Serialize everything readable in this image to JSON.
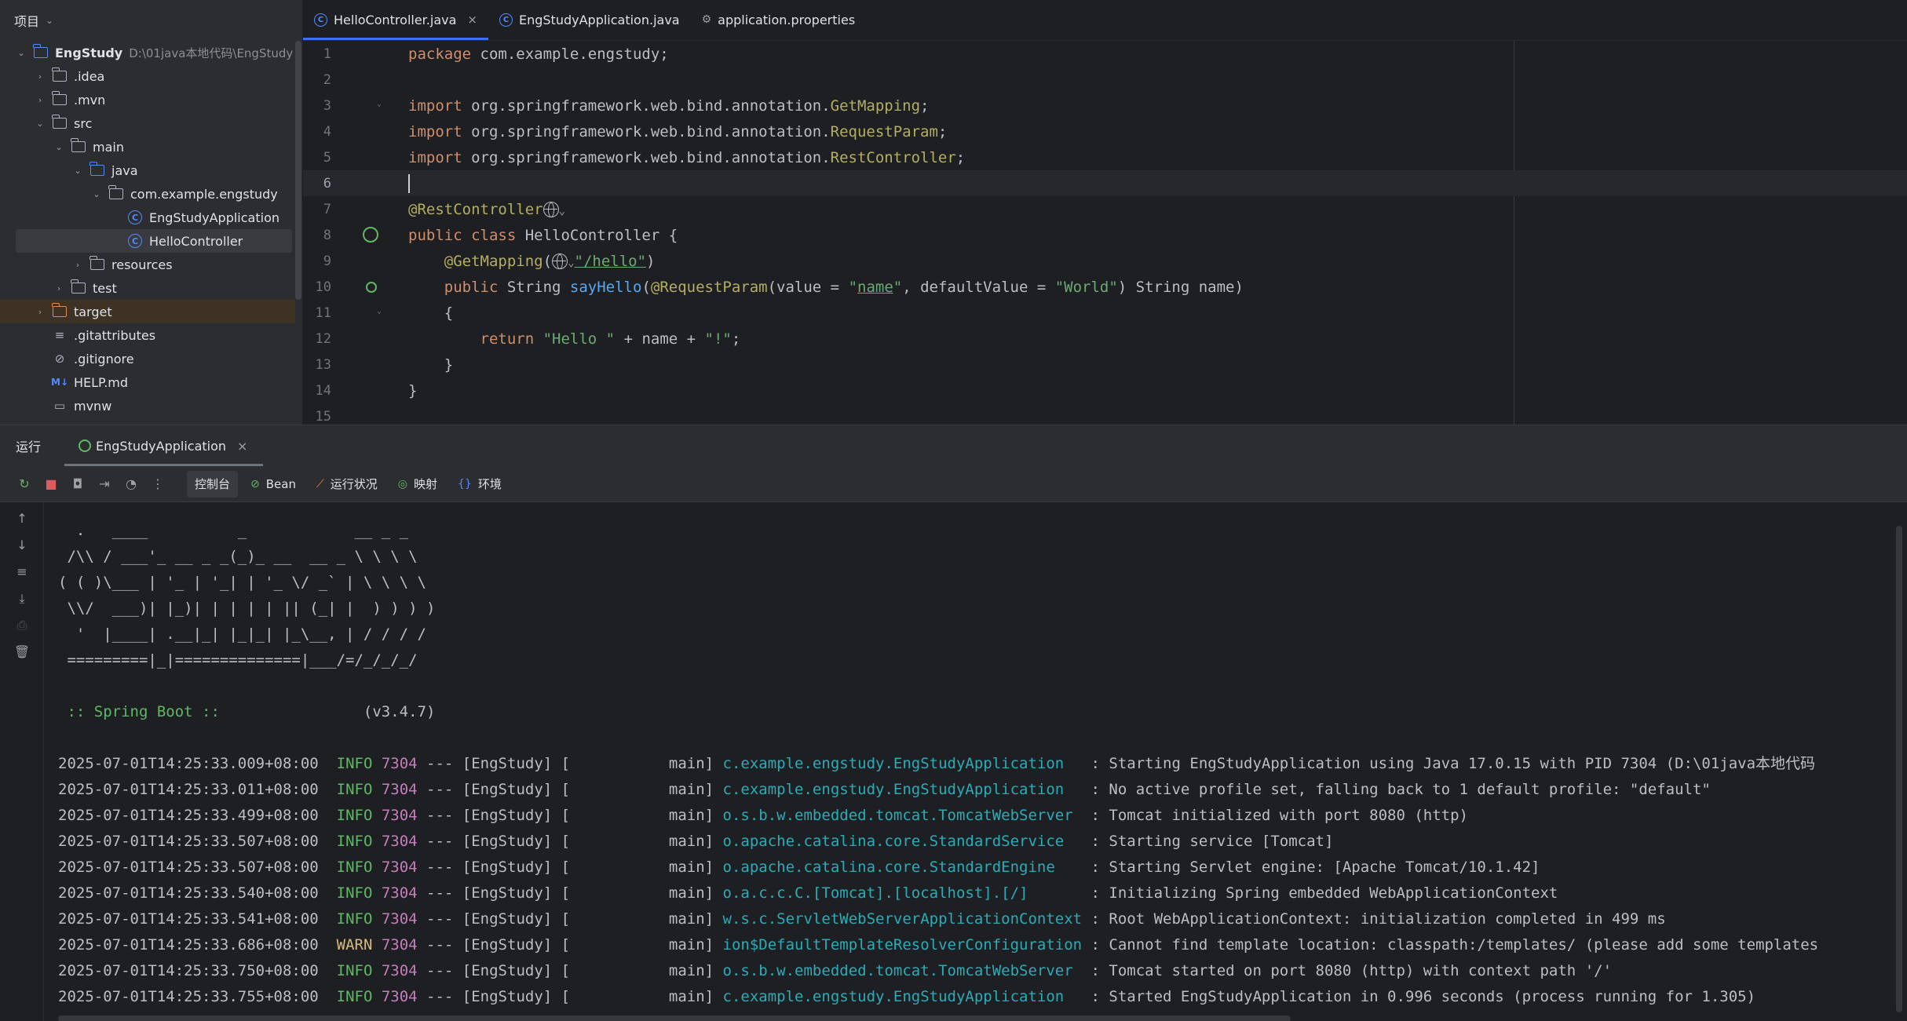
{
  "project": {
    "title": "项目",
    "tree": [
      {
        "label": "EngStudy",
        "hint": "D:\\01java本地代码\\EngStudy",
        "type": "module",
        "arrow": "▾",
        "depth": 0
      },
      {
        "label": ".idea",
        "type": "folder",
        "arrow": "›",
        "depth": 1
      },
      {
        "label": ".mvn",
        "type": "folder",
        "arrow": "›",
        "depth": 1
      },
      {
        "label": "src",
        "type": "folder",
        "arrow": "▾",
        "depth": 1
      },
      {
        "label": "main",
        "type": "folder",
        "arrow": "▾",
        "depth": 2
      },
      {
        "label": "java",
        "type": "folder-blue",
        "arrow": "▾",
        "depth": 3
      },
      {
        "label": "com.example.engstudy",
        "type": "package",
        "arrow": "▾",
        "depth": 4
      },
      {
        "label": "EngStudyApplication",
        "type": "class",
        "arrow": "",
        "depth": 5
      },
      {
        "label": "HelloController",
        "type": "class",
        "arrow": "",
        "depth": 5,
        "selected": true
      },
      {
        "label": "resources",
        "type": "folder",
        "arrow": "›",
        "depth": 3
      },
      {
        "label": "test",
        "type": "folder",
        "arrow": "›",
        "depth": 2
      },
      {
        "label": "target",
        "type": "folder-orange",
        "arrow": "›",
        "depth": 1,
        "highlight": true
      },
      {
        "label": ".gitattributes",
        "type": "text",
        "arrow": "",
        "depth": 1
      },
      {
        "label": ".gitignore",
        "type": "ignore",
        "arrow": "",
        "depth": 1
      },
      {
        "label": "HELP.md",
        "type": "md",
        "arrow": "",
        "depth": 1
      },
      {
        "label": "mvnw",
        "type": "shell",
        "arrow": "",
        "depth": 1
      }
    ]
  },
  "editor": {
    "tabs": [
      {
        "label": "HelloController.java",
        "active": true,
        "closable": true,
        "icon": "class"
      },
      {
        "label": "EngStudyApplication.java",
        "active": false,
        "closable": false,
        "icon": "class"
      },
      {
        "label": "application.properties",
        "active": false,
        "closable": false,
        "icon": "properties"
      }
    ],
    "line_numbers": [
      "1",
      "2",
      "3",
      "4",
      "5",
      "6",
      "7",
      "8",
      "9",
      "10",
      "11",
      "12",
      "13",
      "14",
      "15"
    ],
    "code": {
      "l1_kw": "package",
      "l1_rest": " com.example.engstudy;",
      "import_kw": "import",
      "l3_pkg": " org.springframework.web.bind.annotation.",
      "l3_cls": "GetMapping",
      "l4_cls": "RequestParam",
      "l5_cls": "RestController",
      "semi": ";",
      "l7_ann": "@RestController",
      "l8_kw": "public class",
      "l8_rest": " HelloController {",
      "l9_ann": "@GetMapping",
      "l9_open": "(",
      "l9_str": "\"/hello\"",
      "l9_close": ")",
      "l10_kw": "public",
      "l10_type": " String ",
      "l10_fn": "sayHello",
      "l10_p1": "(",
      "l10_ann": "@RequestParam",
      "l10_p2": "(value = ",
      "l10_q1": "\"",
      "l10_name": "name",
      "l10_q2": "\"",
      "l10_p3": ", defaultValue = ",
      "l10_world": "\"World\"",
      "l10_p4": ") String name)",
      "l11": "{",
      "l12_kw": "return",
      "l12_s1": "\"Hello \"",
      "l12_mid": " + name + ",
      "l12_s2": "\"!\"",
      "l12_end": ";",
      "l13": "}",
      "l14": "}"
    }
  },
  "run": {
    "title": "运行",
    "tab_label": "EngStudyApplication",
    "toolbar_tabs": [
      {
        "label": "控制台",
        "icon": "",
        "active": true
      },
      {
        "label": "Bean",
        "icon": "⊘",
        "active": false
      },
      {
        "label": "运行状况",
        "icon": "⟋",
        "active": false
      },
      {
        "label": "映射",
        "icon": "◎",
        "active": false
      },
      {
        "label": "环境",
        "icon": "{}",
        "active": false
      }
    ],
    "banner": [
      "  .   ____          _            __ _ _",
      " /\\\\ / ___'_ __ _ _(_)_ __  __ _ \\ \\ \\ \\",
      "( ( )\\___ | '_ | '_| | '_ \\/ _` | \\ \\ \\ \\",
      " \\\\/  ___)| |_)| | | | | || (_| |  ) ) ) )",
      "  '  |____| .__|_| |_|_| |_\\__, | / / / /",
      " =========|_|==============|___/=/_/_/_/"
    ],
    "spring_label": " :: Spring Boot ::",
    "spring_version": "                (v3.4.7)",
    "logs": [
      {
        "ts": "2025-07-01T14:25:33.009+08:00",
        "level": "INFO",
        "pid": "7304",
        "mid": " --- [EngStudy] [           main] ",
        "logger": "c.example.engstudy.EngStudyApplication   ",
        "msg": ": Starting EngStudyApplication using Java 17.0.15 with PID 7304 (D:\\01java本地代码"
      },
      {
        "ts": "2025-07-01T14:25:33.011+08:00",
        "level": "INFO",
        "pid": "7304",
        "mid": " --- [EngStudy] [           main] ",
        "logger": "c.example.engstudy.EngStudyApplication   ",
        "msg": ": No active profile set, falling back to 1 default profile: \"default\""
      },
      {
        "ts": "2025-07-01T14:25:33.499+08:00",
        "level": "INFO",
        "pid": "7304",
        "mid": " --- [EngStudy] [           main] ",
        "logger": "o.s.b.w.embedded.tomcat.TomcatWebServer  ",
        "msg": ": Tomcat initialized with port 8080 (http)"
      },
      {
        "ts": "2025-07-01T14:25:33.507+08:00",
        "level": "INFO",
        "pid": "7304",
        "mid": " --- [EngStudy] [           main] ",
        "logger": "o.apache.catalina.core.StandardService   ",
        "msg": ": Starting service [Tomcat]"
      },
      {
        "ts": "2025-07-01T14:25:33.507+08:00",
        "level": "INFO",
        "pid": "7304",
        "mid": " --- [EngStudy] [           main] ",
        "logger": "o.apache.catalina.core.StandardEngine    ",
        "msg": ": Starting Servlet engine: [Apache Tomcat/10.1.42]"
      },
      {
        "ts": "2025-07-01T14:25:33.540+08:00",
        "level": "INFO",
        "pid": "7304",
        "mid": " --- [EngStudy] [           main] ",
        "logger": "o.a.c.c.C.[Tomcat].[localhost].[/]       ",
        "msg": ": Initializing Spring embedded WebApplicationContext"
      },
      {
        "ts": "2025-07-01T14:25:33.541+08:00",
        "level": "INFO",
        "pid": "7304",
        "mid": " --- [EngStudy] [           main] ",
        "logger": "w.s.c.ServletWebServerApplicationContext ",
        "msg": ": Root WebApplicationContext: initialization completed in 499 ms"
      },
      {
        "ts": "2025-07-01T14:25:33.686+08:00",
        "level": "WARN",
        "pid": "7304",
        "mid": " --- [EngStudy] [           main] ",
        "logger": "ion$DefaultTemplateResolverConfiguration ",
        "msg": ": Cannot find template location: classpath:/templates/ (please add some templates"
      },
      {
        "ts": "2025-07-01T14:25:33.750+08:00",
        "level": "INFO",
        "pid": "7304",
        "mid": " --- [EngStudy] [           main] ",
        "logger": "o.s.b.w.embedded.tomcat.TomcatWebServer  ",
        "msg": ": Tomcat started on port 8080 (http) with context path '/'"
      },
      {
        "ts": "2025-07-01T14:25:33.755+08:00",
        "level": "INFO",
        "pid": "7304",
        "mid": " --- [EngStudy] [           main] ",
        "logger": "c.example.engstudy.EngStudyApplication   ",
        "msg": ": Started EngStudyApplication in 0.996 seconds (process running for 1.305)"
      }
    ]
  },
  "colors": {
    "accent": "#3574f0",
    "run_green": "#5fb865",
    "stop_red": "#db5c5c",
    "keyword": "#cf8e6d",
    "string": "#6aab73",
    "annotation": "#b3ae60",
    "logger": "#2aacb8",
    "pid": "#c77dbb"
  }
}
